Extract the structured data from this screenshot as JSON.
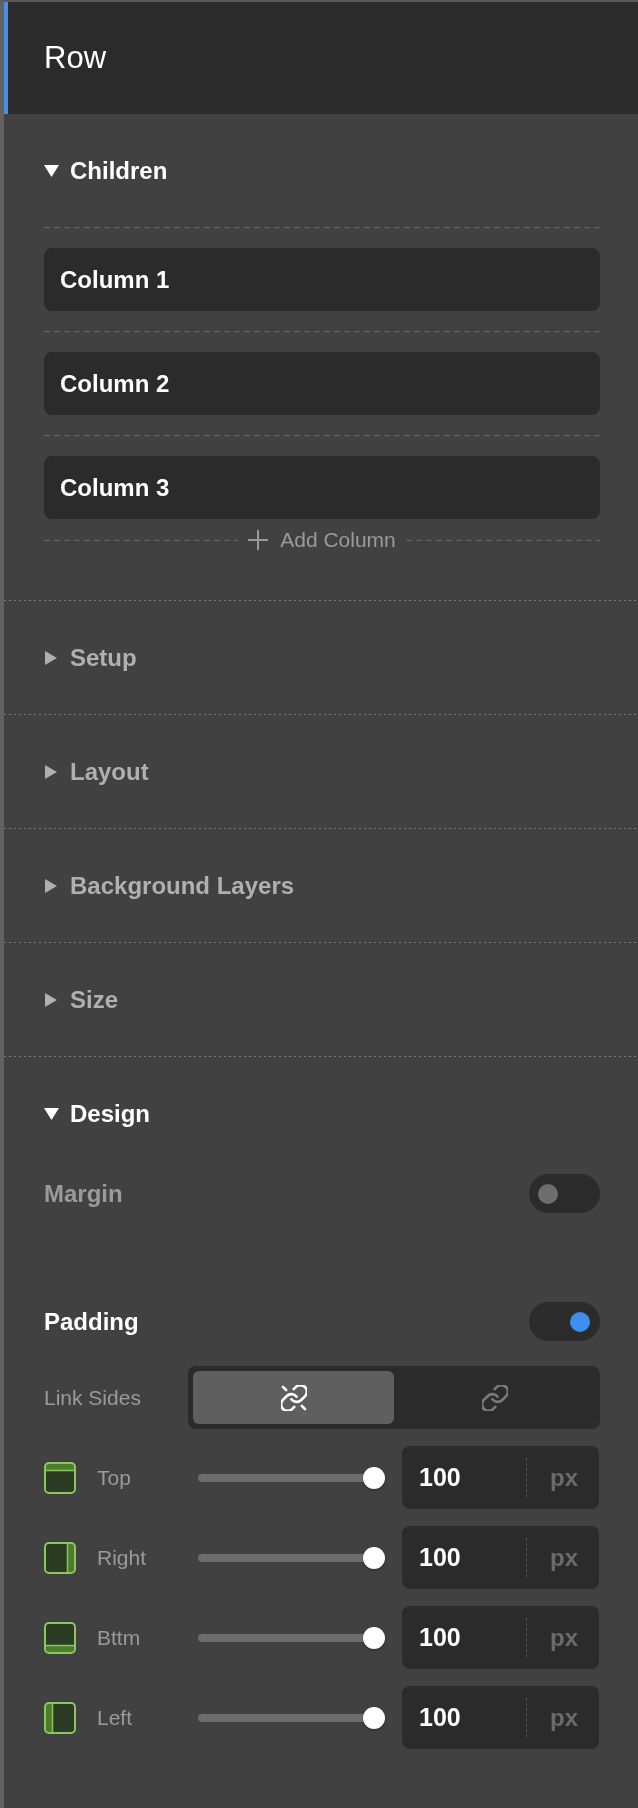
{
  "panel": {
    "title": "Row"
  },
  "sections": [
    {
      "title": "Children",
      "expanded": true,
      "columns": [
        {
          "label": "Column 1"
        },
        {
          "label": "Column 2"
        },
        {
          "label": "Column 3"
        }
      ],
      "add_button": {
        "label": "Add Column"
      }
    },
    {
      "title": "Setup",
      "expanded": false
    },
    {
      "title": "Layout",
      "expanded": false
    },
    {
      "title": "Background Layers",
      "expanded": false
    },
    {
      "title": "Size",
      "expanded": false
    },
    {
      "title": "Design",
      "expanded": true,
      "margin": {
        "label": "Margin",
        "on": false
      },
      "padding": {
        "label": "Padding",
        "on": true,
        "link_sides": {
          "label": "Link Sides",
          "options": [
            {
              "kind": "unlinked",
              "selected": true
            },
            {
              "kind": "linked",
              "selected": false
            }
          ]
        },
        "sides": [
          {
            "kind": "top",
            "label": "Top",
            "level": 1,
            "value": "100",
            "unit": "px"
          },
          {
            "kind": "right",
            "label": "Right",
            "level": 1,
            "value": "100",
            "unit": "px"
          },
          {
            "kind": "bottom",
            "label": "Bttm",
            "level": 1,
            "value": "100",
            "unit": "px"
          },
          {
            "kind": "left",
            "label": "Left",
            "level": 1,
            "value": "100",
            "unit": "px"
          }
        ]
      }
    }
  ]
}
